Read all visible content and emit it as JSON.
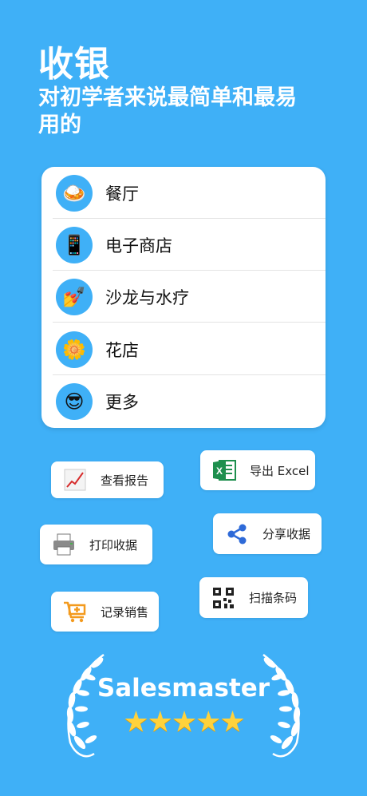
{
  "header": {
    "title": "收银",
    "subtitle": "对初学者来说最简单和最易用的"
  },
  "categories": [
    {
      "label": "餐厅",
      "icon": "curry-rice-emoji"
    },
    {
      "label": "电子商店",
      "icon": "mobile-phone-emoji"
    },
    {
      "label": "沙龙与水疗",
      "icon": "nail-polish-emoji"
    },
    {
      "label": "花店",
      "icon": "sunflower-emoji"
    },
    {
      "label": "更多",
      "icon": "sunglasses-face-emoji"
    }
  ],
  "features": {
    "view_reports": "查看报告",
    "export_excel": "导出 Excel",
    "print_receipt": "打印收据",
    "share_receipt": "分享收据",
    "scan_barcode": "扫描条码",
    "record_sales": "记录销售"
  },
  "brand": {
    "name": "Salesmaster",
    "rating": 5,
    "stars": "★★★★★"
  },
  "colors": {
    "background": "#3fb0f7",
    "excel_green": "#1e8f4e",
    "cart_orange": "#f39a1e",
    "share_blue": "#2e6ad8"
  }
}
